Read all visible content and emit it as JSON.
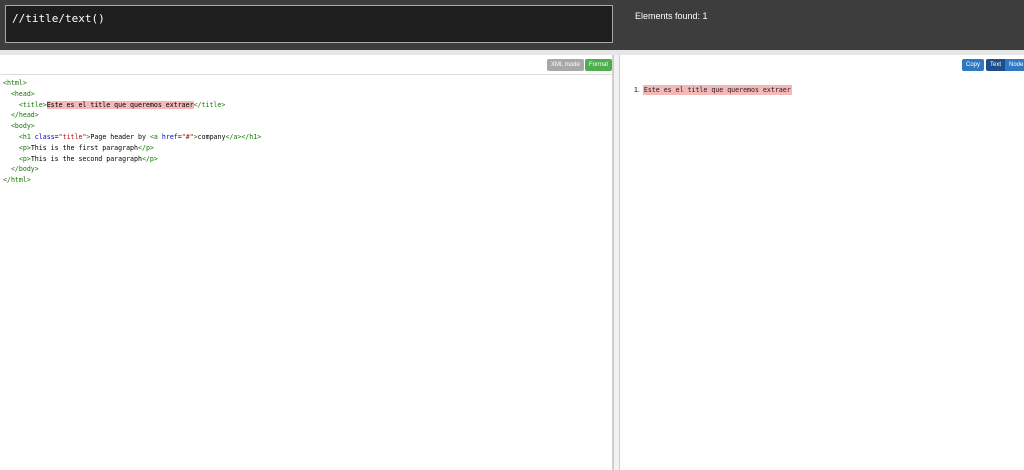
{
  "query": {
    "value": "//title/text()"
  },
  "status": {
    "elements_found": "Elements found: 1"
  },
  "editor": {
    "xml_mode_label": "XML mode",
    "format_label": "Format",
    "lines": [
      {
        "indent": "",
        "parts": [
          {
            "t": "tag",
            "v": "<html>"
          }
        ]
      },
      {
        "indent": "  ",
        "parts": [
          {
            "t": "tag",
            "v": "<head>"
          }
        ]
      },
      {
        "indent": "    ",
        "parts": [
          {
            "t": "tag",
            "v": "<title>"
          },
          {
            "t": "hl",
            "v": "Este es el title que queremos extraer"
          },
          {
            "t": "tag",
            "v": "</title>"
          }
        ]
      },
      {
        "indent": "  ",
        "parts": [
          {
            "t": "tag",
            "v": "</head>"
          }
        ]
      },
      {
        "indent": "  ",
        "parts": [
          {
            "t": "tag",
            "v": "<body>"
          }
        ]
      },
      {
        "indent": "    ",
        "parts": [
          {
            "t": "tag",
            "v": "<h1 "
          },
          {
            "t": "attr",
            "v": "class"
          },
          {
            "t": "txt",
            "v": "="
          },
          {
            "t": "str",
            "v": "\"title\""
          },
          {
            "t": "tag",
            "v": ">"
          },
          {
            "t": "txt",
            "v": "Page header by "
          },
          {
            "t": "tag",
            "v": "<a "
          },
          {
            "t": "attr",
            "v": "href"
          },
          {
            "t": "txt",
            "v": "="
          },
          {
            "t": "str",
            "v": "\"#\""
          },
          {
            "t": "tag",
            "v": ">"
          },
          {
            "t": "txt",
            "v": "company"
          },
          {
            "t": "tag",
            "v": "</a></h1>"
          }
        ]
      },
      {
        "indent": "    ",
        "parts": [
          {
            "t": "tag",
            "v": "<p>"
          },
          {
            "t": "txt",
            "v": "This is the first paragraph"
          },
          {
            "t": "tag",
            "v": "</p>"
          }
        ]
      },
      {
        "indent": "    ",
        "parts": [
          {
            "t": "tag",
            "v": "<p>"
          },
          {
            "t": "txt",
            "v": "This is the second paragraph"
          },
          {
            "t": "tag",
            "v": "</p>"
          }
        ]
      },
      {
        "indent": "  ",
        "parts": [
          {
            "t": "tag",
            "v": "</body>"
          }
        ]
      },
      {
        "indent": "",
        "parts": [
          {
            "t": "tag",
            "v": "</html>"
          }
        ]
      }
    ]
  },
  "results_panel": {
    "copy_label": "Copy",
    "text_label": "Text",
    "node_label": "Node",
    "results": [
      {
        "number": "1.",
        "value": "Este es el title que queremos extraer"
      }
    ]
  },
  "colors": {
    "tag": "#117700",
    "attr": "#0000cc",
    "string": "#aa1111",
    "highlight": "#f4b8b8",
    "format_button": "#4cae4c",
    "primary_button": "#3079c2"
  }
}
